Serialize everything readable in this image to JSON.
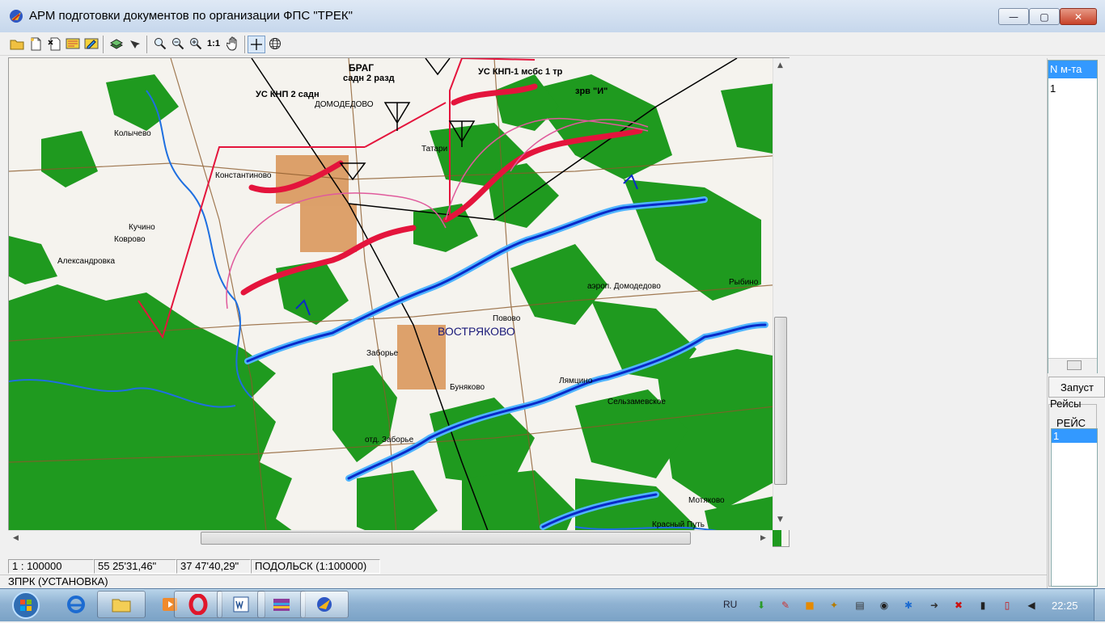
{
  "window": {
    "title": "АРМ подготовки документов по организации ФПС \"ТРЕК\"",
    "controls": {
      "minimize": "—",
      "maximize": "▢",
      "close": "✕"
    }
  },
  "toolbar": {
    "icons": [
      "open-icon",
      "new-icon",
      "delete-icon",
      "save-icon",
      "edit-icon",
      "layers-icon",
      "pointer-icon",
      "zoom-icon",
      "zoom-out-icon",
      "zoom-in-icon",
      "one-to-one-icon",
      "hand-icon",
      "crosshair-icon",
      "globe-icon"
    ],
    "one_to_one_label": "1:1"
  },
  "map": {
    "labels": {
      "vostryakovo": "ВОСТРЯКОВО",
      "domodedovo": "ДОМОДЕДОВО",
      "bragi": "БРАГ",
      "sadn2": "садн 2 разд",
      "kp1": "УС КНП-1 мсбс 1 тр",
      "kp2": "УС КНП 2 садн",
      "zrv": "зрв \"И\"",
      "tatarintsevo": "Татари",
      "konstantinovo": "Константиново",
      "aleksandrovka": "Александровка",
      "kolychevo": "Колычево",
      "zaborye": "отд. Заборье",
      "kuchino": "Кучино",
      "lyamtsino": "Лямцино",
      "salvamevskoe": "Сельзамевское",
      "krasny_put": "Красный Путь",
      "aerodrome": "аэроп. Домодедово",
      "vykhino": "Рыбино",
      "zaborye2": "Заборье",
      "bunyakovo": "Буняково",
      "kolovo": "Коврово",
      "povyovo": "Повово",
      "motyakino": "Мотяково"
    }
  },
  "status": {
    "scale": "1 : 100000",
    "lat": "55 25'31,46\"",
    "lon": "37 47'40,29\"",
    "map_name": "ПОДОЛЬСК (1:100000)",
    "mode": "ЗПРК (УСТАНОВКА)"
  },
  "right_panel": {
    "list_header": "N м-та",
    "list_row": "1",
    "run_button": "Запуст",
    "group_label": "Рейсы",
    "trips_title": "РЕЙС",
    "trips_selected": "1"
  },
  "taskbar": {
    "lang": "RU",
    "time": "22:25",
    "apps": [
      "ie-icon",
      "explorer-icon",
      "media-player-icon",
      "opera-icon",
      "word-icon",
      "archive-icon",
      "trek-app-icon"
    ]
  }
}
